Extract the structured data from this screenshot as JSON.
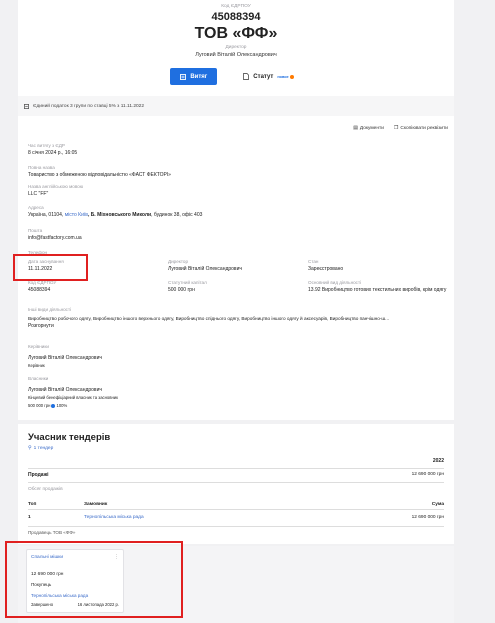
{
  "header": {
    "code_label": "Код ЄДРПОУ",
    "code_value": "45088394",
    "company_name": "ТОВ «ФФ»",
    "director_label": "Директор",
    "director_name": "Луговий Віталій Олександрович",
    "extract_button": "Витяг",
    "status_button": "Статут",
    "status_badge": "новое"
  },
  "tax_bar": {
    "text": "Єдиний податок 3 групи по ставці 5% з 11.11.2022"
  },
  "toolbar": {
    "documents": "Документи",
    "copy_details": "Скопіювати реквізити"
  },
  "details": {
    "extract_time_label": "Час витягу з ЄДР",
    "extract_time_value": "8 січня 2024 р., 16:05",
    "full_name_label": "Повна назва",
    "full_name_value": "Товариство з обмеженою відповідальністю «ФАСТ ФЕКТОРІ»",
    "english_name_label": "Назва англійською мовою",
    "english_name_value": "LLC \"FF\"",
    "address_label": "Адреса",
    "address_prefix": "Україна, 01104, ",
    "address_city": "місто Київ",
    "address_street": ", Б. Міхновського Миколи",
    "address_suffix": ", будинок 38, офіс 403",
    "email_label": "Пошта",
    "email_value": "info@fastfactory.com.ua",
    "phone_label": "Телефон",
    "reg_date_label": "Дата заснування",
    "reg_date_value": "11.11.2022",
    "director_label": "Директор",
    "director_value": "Луговий Віталій Олександрович",
    "status_label": "Стан",
    "status_value": "Зареєстровано",
    "edrpou_label": "Код ЄДРПОУ",
    "edrpou_value": "45088394",
    "capital_label": "Статутний капітал",
    "capital_value": "500 000 грн",
    "main_activity_label": "Основний вид діяльності",
    "main_activity_value": "13.92 Виробництво готових текстильних виробів, крім одягу",
    "other_activity_label": "Інші види діяльності",
    "other_activity_value": "Виробництво робочого одягу, Виробництво іншого верхнього одягу, Виробництво спіднього одягу, Виробництво іншого одягу й аксесуарів, Виробництво панчішно-ш...",
    "expand_link": "Розгорнути",
    "manager_label": "Керівники",
    "manager_name": "Луговий Віталій Олександрович",
    "manager_role": "Керівник",
    "owner_label": "Власники",
    "owner_name": "Луговий Віталій Олександрович",
    "owner_role": "Кінцевий бенефіціарний власник та засновник",
    "owner_share": "500 000 грн",
    "owner_percent": "100%"
  },
  "tenders": {
    "title": "Учасник тендерів",
    "count_link": "1 тендер",
    "year": "2022",
    "sales_label": "Продажі",
    "sales_value": "12 690 000 грн",
    "volume_label": "Обсяг продажів",
    "col_top": "Топ",
    "col_customer": "Замовник",
    "col_sum": "Сума",
    "row_rank": "1",
    "row_customer": "Тернопільська міська рада",
    "row_sum": "12 690 000 грн",
    "sales_note": "Продавець ТОВ «ФФ»"
  },
  "tender_card": {
    "title": "Спальні мішки",
    "amount": "12 690 000 грн",
    "role": "Покупець",
    "customer": "Тернопільська міська рада",
    "status": "Завершено",
    "date": "16 листопада 2022 р."
  },
  "colors": {
    "primary": "#1f6fe0",
    "link": "#3a6bc9",
    "person": "#8a3f8f",
    "highlight": "#e02020"
  }
}
